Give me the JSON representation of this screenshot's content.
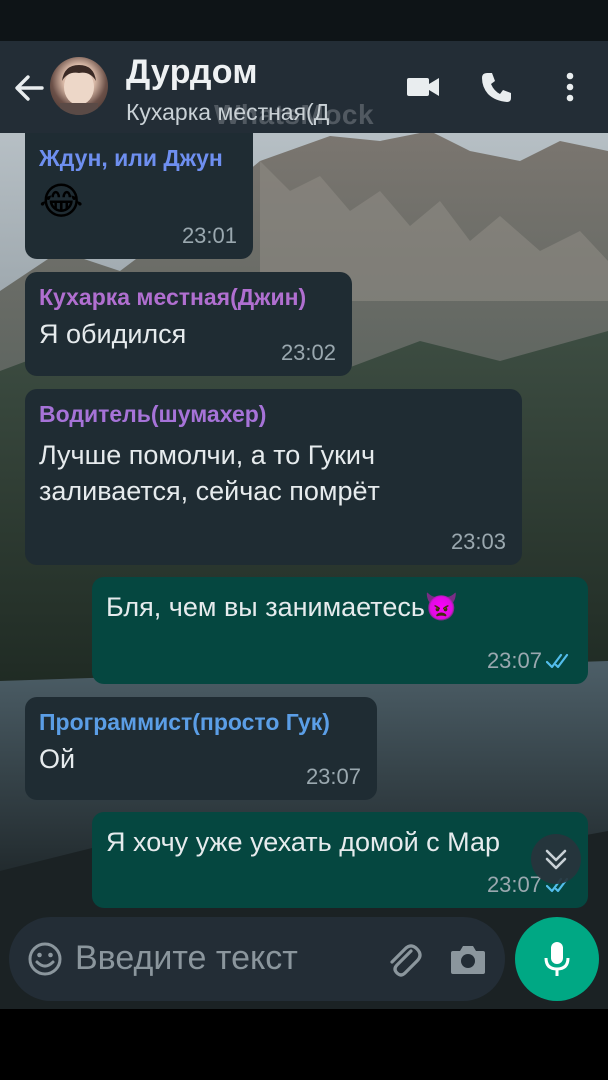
{
  "header": {
    "title": "Дурдом",
    "subtitle": "Кухарка местная(Д",
    "watermark": "WhatsMock",
    "icons": [
      "back-arrow-icon",
      "video-call-icon",
      "phone-icon",
      "more-vert-icon"
    ]
  },
  "messages": [
    {
      "type": "in",
      "sender": "Ждун, или Джун",
      "sender_color": "#6e8ff0",
      "text": "😂",
      "time": "23:01"
    },
    {
      "type": "in",
      "sender": "Кухарка местная(Джин)",
      "sender_color": "#b06fd0",
      "text": "Я обидился",
      "time": "23:02"
    },
    {
      "type": "in",
      "sender": "Водитель(шумахер)",
      "sender_color": "#a673d8",
      "text_line1": "Лучше помолчи, а то Гукич",
      "text_line2": "заливается, сейчас помрёт",
      "time": "23:03"
    },
    {
      "type": "out",
      "text": "Бля, чем вы занимаетесь👿",
      "time": "23:07",
      "status": "read"
    },
    {
      "type": "in",
      "sender": "Программист(просто Гук)",
      "sender_color": "#5b9ee6",
      "text": "Ой",
      "time": "23:07"
    },
    {
      "type": "out",
      "text": "Я хочу уже уехать домой с Мар",
      "time": "23:07",
      "status": "read"
    }
  ],
  "composer": {
    "placeholder": "Введите текст",
    "icons": [
      "emoji-icon",
      "attach-icon",
      "camera-icon",
      "mic-icon"
    ]
  },
  "colors": {
    "header_bg": "#232d36",
    "incoming_bubble": "#1f2c33",
    "outgoing_bubble": "#054740",
    "accent": "#00a884",
    "read_ticks": "#53bdeb"
  }
}
